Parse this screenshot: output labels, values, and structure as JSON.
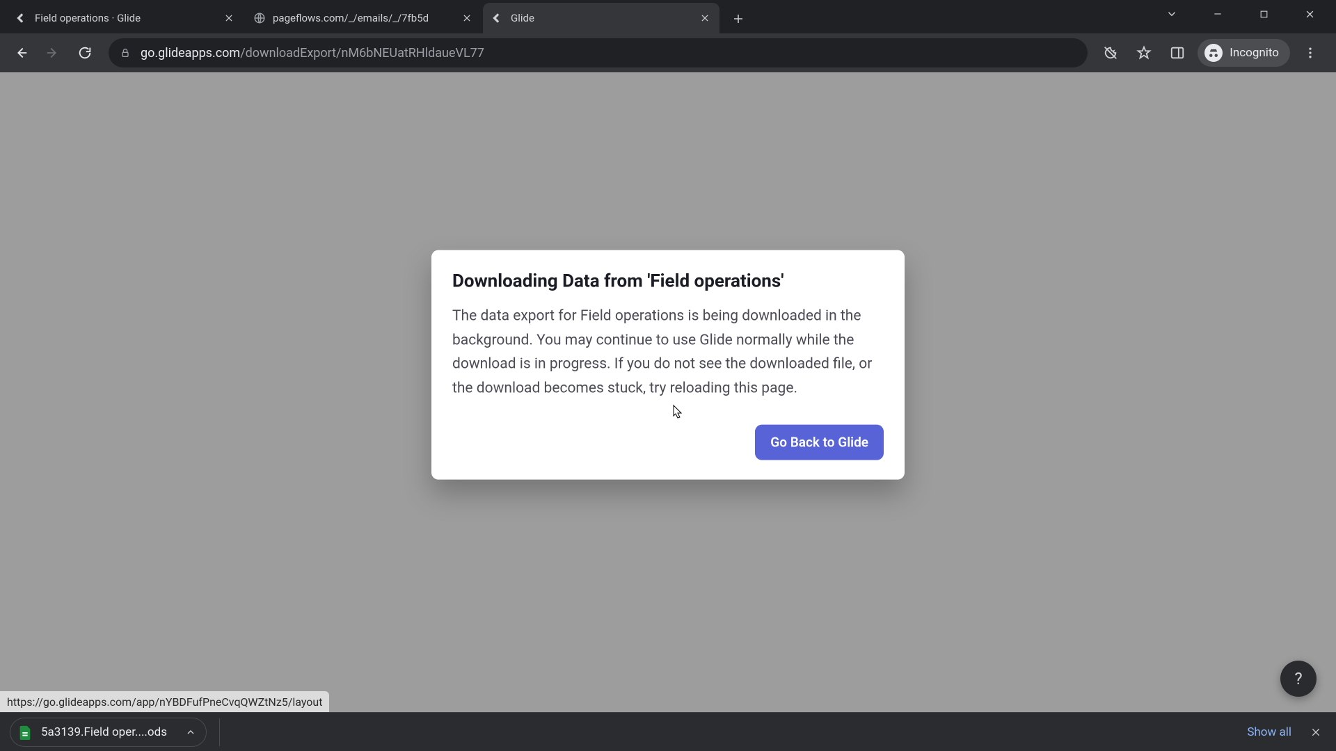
{
  "browser": {
    "tabs": [
      {
        "title": "Field operations · Glide",
        "icon": "glide"
      },
      {
        "title": "pageflows.com/_/emails/_/7fb5d",
        "icon": "globe"
      },
      {
        "title": "Glide",
        "icon": "glide"
      }
    ],
    "active_tab_index": 2,
    "url_host": "go.glideapps.com",
    "url_path": "/downloadExport/nM6bNEUatRHldaueVL77",
    "incognito_label": "Incognito"
  },
  "dialog": {
    "title": "Downloading Data from 'Field operations'",
    "body": "The data export for Field operations is being downloaded in the background. You may continue to use Glide normally while the download is in progress. If you do not see the downloaded file, or the download becomes stuck, try reloading this page.",
    "primary_button": "Go Back to Glide"
  },
  "status_url": "https://go.glideapps.com/app/nYBDFufPneCvqQWZtNz5/layout",
  "downloads": {
    "item_filename": "5a3139.Field oper....ods",
    "show_all": "Show all"
  },
  "help_glyph": "?"
}
